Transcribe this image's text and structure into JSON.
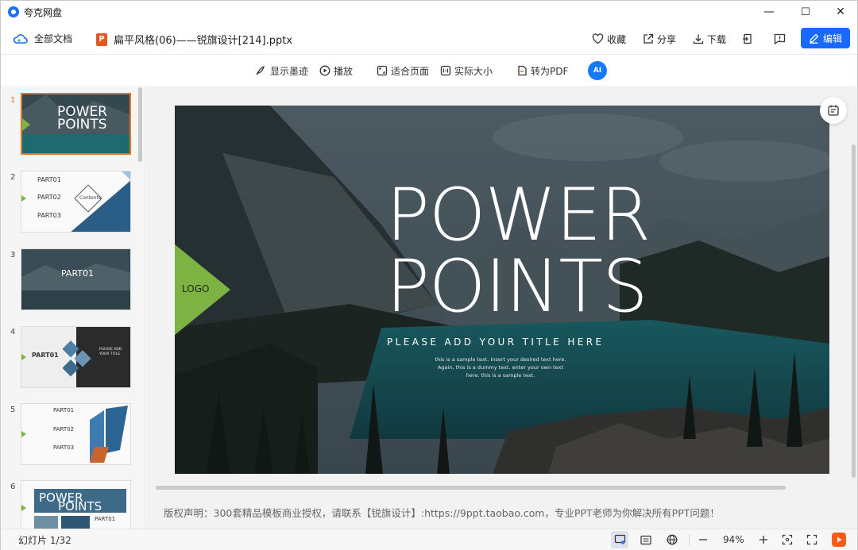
{
  "app": {
    "title": "夸克网盘"
  },
  "window_controls": {
    "minimize": "—",
    "maximize": "☐",
    "close": "✕"
  },
  "header": {
    "all_docs": "全部文档",
    "file_badge": "P",
    "file_name": "扁平风格(06)——锐旗设计[214].pptx",
    "favorite": "收藏",
    "share": "分享",
    "download": "下载",
    "edit": "编辑"
  },
  "toolbar": {
    "show_ink": "显示墨迹",
    "play": "播放",
    "fit_page": "适合页面",
    "actual_size": "实际大小",
    "to_pdf": "转为PDF",
    "ai": "AI"
  },
  "thumbnails": [
    {
      "num": "1",
      "title1": "POWER",
      "title2": "POINTS"
    },
    {
      "num": "2",
      "p1": "PART01",
      "p2": "PART02",
      "p3": "PART03",
      "center": "Contents"
    },
    {
      "num": "3",
      "title": "PART01"
    },
    {
      "num": "4",
      "title": "PART01",
      "side": "PLEASE ADD YOUR TITLE"
    },
    {
      "num": "5",
      "p1": "PART01",
      "p2": "PART02",
      "p3": "PART03"
    },
    {
      "num": "6",
      "title1": "POWER",
      "title2": "POINTS",
      "part": "PART01"
    }
  ],
  "slide": {
    "logo": "LOGO",
    "title1": "POWER",
    "title2": "POINTS",
    "subtitle": "PLEASE ADD YOUR TITLE HERE",
    "body1": "this is a sample text. Insert your desired text here.",
    "body2": "Again, this is a dummy text. enter your own text",
    "body3": "here. this is a sample text."
  },
  "copyright": "版权声明：300套精品模板商业授权，请联系【锐旗设计】:https://9ppt.taobao.com，专业PPT老师为你解决所有PPT问题！",
  "status": {
    "slide_counter": "幻灯片 1/32",
    "zoom": "94%"
  },
  "colors": {
    "accent": "#1769ff",
    "green": "#7cb342",
    "ppt_orange": "#e8561f",
    "selected": "#e8761f"
  }
}
